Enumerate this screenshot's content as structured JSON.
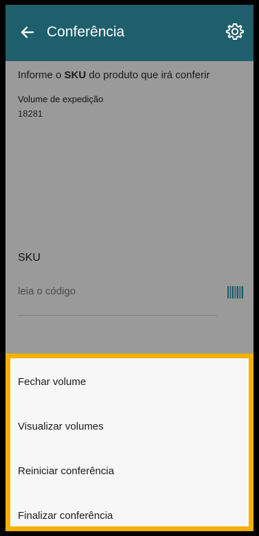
{
  "header": {
    "title": "Conferência",
    "back_icon": "arrow-left-icon",
    "settings_icon": "gear-icon",
    "color": "#1e5f6b"
  },
  "content": {
    "instruction_prefix": "Informe o ",
    "instruction_bold": "SKU",
    "instruction_suffix": " do produto que irá conferir",
    "volume_label": "Volume de expedição",
    "volume_value": "18281",
    "sku_label": "SKU",
    "sku_placeholder": "leia o código",
    "barcode_icon": "barcode-icon"
  },
  "sheet": {
    "highlight_color": "#f5b100",
    "items": [
      {
        "label": "Fechar volume"
      },
      {
        "label": "Visualizar volumes"
      },
      {
        "label": "Reiniciar conferência"
      },
      {
        "label": "Finalizar conferência"
      }
    ]
  }
}
